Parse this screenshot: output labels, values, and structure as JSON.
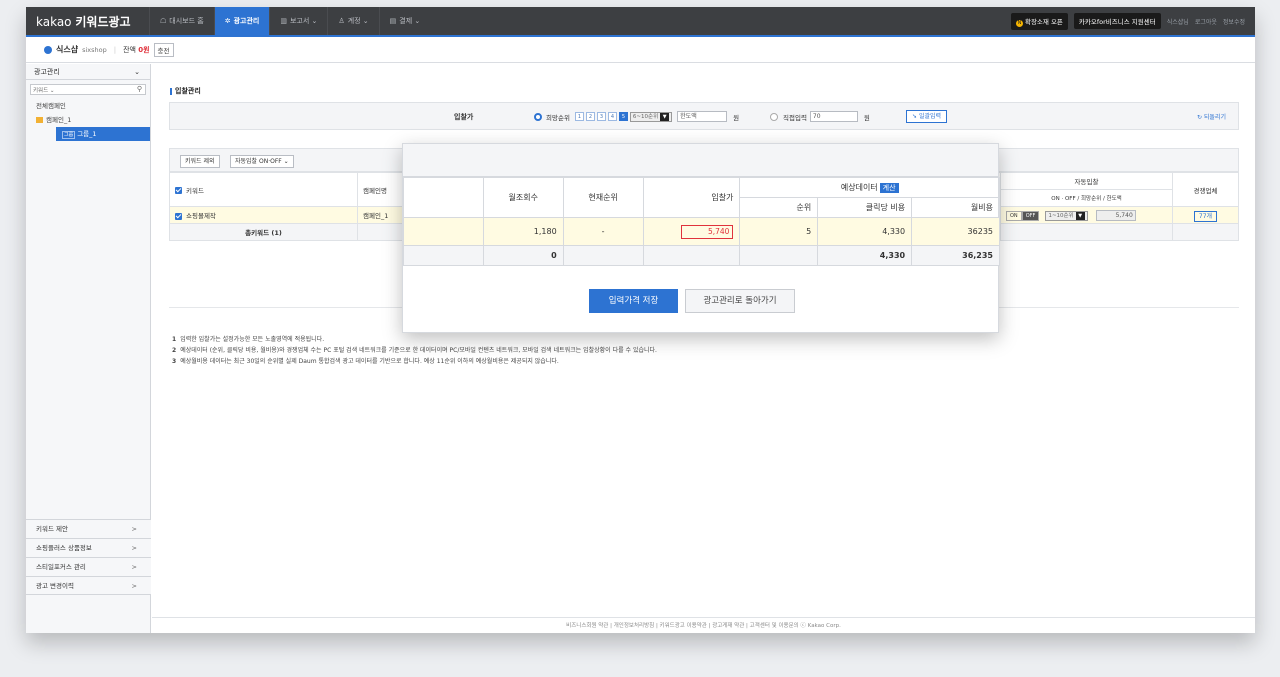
{
  "app": {
    "logo_a": "kakao",
    "logo_b": "키워드광고"
  },
  "gnb": [
    {
      "icon": "☖",
      "label": "대시보드 홈"
    },
    {
      "icon": "✲",
      "label": "광고관리"
    },
    {
      "icon": "▥",
      "label": "보고서 ⌄"
    },
    {
      "icon": "♙",
      "label": "계정 ⌄"
    },
    {
      "icon": "▤",
      "label": "결제 ⌄"
    }
  ],
  "util": {
    "promo": "확장소재 오픈",
    "biz": "카카오for비즈니스 지원센터",
    "links": [
      "식스샵님",
      "로그아웃",
      "정보수정"
    ]
  },
  "account": {
    "name": "식스샵",
    "id": "sixshop",
    "balance_label": "잔액",
    "balance": "0원",
    "charge": "충전"
  },
  "sidebar": {
    "head": "광고관리",
    "chev": "⌄",
    "filter": "키워드 ⌄",
    "search_icon": "⚲",
    "tree": [
      "전체캠페인",
      "캠페인_1",
      "그룹_1"
    ],
    "group_tag": "그룹",
    "bottom": [
      {
        "label": "키워드 제안",
        "chev": ">"
      },
      {
        "label": "쇼핑플러스 상품정보",
        "chev": ">"
      },
      {
        "label": "스티일포커스 관리",
        "chev": ">"
      },
      {
        "label": "광고 변경이력",
        "chev": ">"
      }
    ]
  },
  "page": {
    "title": "입찰관리"
  },
  "bidbar": {
    "label": "입찰가",
    "opt1": "희망순위",
    "nums": [
      "1",
      "2",
      "3",
      "4",
      "5"
    ],
    "range": "6~10순위",
    "limit_ph": "한도액",
    "won1": "원",
    "opt2": "직접입력",
    "direct": "70",
    "won2": "원",
    "apply": "일괄입력",
    "apply_icon": "➘",
    "back": "되돌리기",
    "back_icon": "↻"
  },
  "toolbar": {
    "exclude": "키워드 제외",
    "auto": "자동입찰 ON·OFF",
    "auto_arrow": "⌄"
  },
  "table": {
    "h_keyword": "키워드",
    "h_campaign": "캠페인명",
    "h_auto": "자동입찰",
    "h_auto_sub": "ON · OFF / 희망순위 / 한도액",
    "h_comp": "경쟁업체",
    "row_keyword": "쇼핑몰제작",
    "row_campaign": "캠페인_1",
    "row_on": "ON",
    "row_off": "OFF",
    "row_range": "1~10순위",
    "row_limit": "5,740",
    "row_comp": "77개",
    "total": "총키워드 (1)"
  },
  "notes": [
    {
      "n": "1",
      "t": "입력한 입찰가는 설정가능한 모든 노출영역에 적용됩니다."
    },
    {
      "n": "2",
      "t": "예상데이터 (순위, 클릭당 비용, 월비용)와 경쟁업체 수는 PC 포털 검색 네트워크를 기준으로 한 데이터이며 PC/모바일 컨텐츠 네트워크, 모바일 검색 네트워크는 입찰상황이 다를 수 있습니다."
    },
    {
      "n": "3",
      "t": "예상월비용 데이터는 최근 30일의 순위별 실제 Daum 통합검색 광고 데이터를 기반으로 합니다. 예상 11순위 이하의 예상월비용은 제공되지 않습니다."
    }
  ],
  "popup": {
    "h_search": "월조회수",
    "h_rank": "현재순위",
    "h_bid": "입찰가",
    "h_forecast": "예상데이터",
    "calc": "계산",
    "h_frank": "순위",
    "h_cpc": "클릭당 비용",
    "h_month": "월비용",
    "r_search": "1,180",
    "r_rank": "-",
    "r_bid": "5,740",
    "r_frank": "5",
    "r_cpc": "4,330",
    "r_month": "36235",
    "t_search": "0",
    "t_cpc": "4,330",
    "t_month": "36,235",
    "save": "입력가격 저장",
    "return": "광고관리로 돌아가기"
  },
  "footer": "비즈니스회원 약관 | 개인정보처리방침 | 키워드광고 이용약관 | 광고게재 약관 | 고객센터 및 이용문의  ⓒ Kakao Corp.",
  "colors": {
    "accent": "#2d73d2",
    "topbar": "#3d3f42",
    "danger": "#e0323c",
    "highlight": "#fffbe2"
  }
}
